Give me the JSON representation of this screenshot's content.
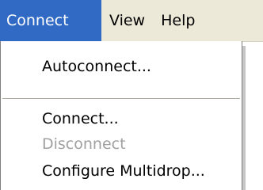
{
  "menubar": {
    "items": [
      {
        "label": "Connect",
        "selected": true
      },
      {
        "label": "View"
      },
      {
        "label": "Help"
      }
    ]
  },
  "dropdown": {
    "items": [
      {
        "label": "Autoconnect...",
        "enabled": true
      },
      {
        "label": "Connect...",
        "enabled": true
      },
      {
        "label": "Disconnect",
        "enabled": false
      },
      {
        "label": "Configure Multidrop...",
        "enabled": true
      }
    ]
  },
  "colors": {
    "menubar_bg": "#ece9d8",
    "highlight": "#316ac5",
    "disabled_text": "#a0a0a0"
  }
}
